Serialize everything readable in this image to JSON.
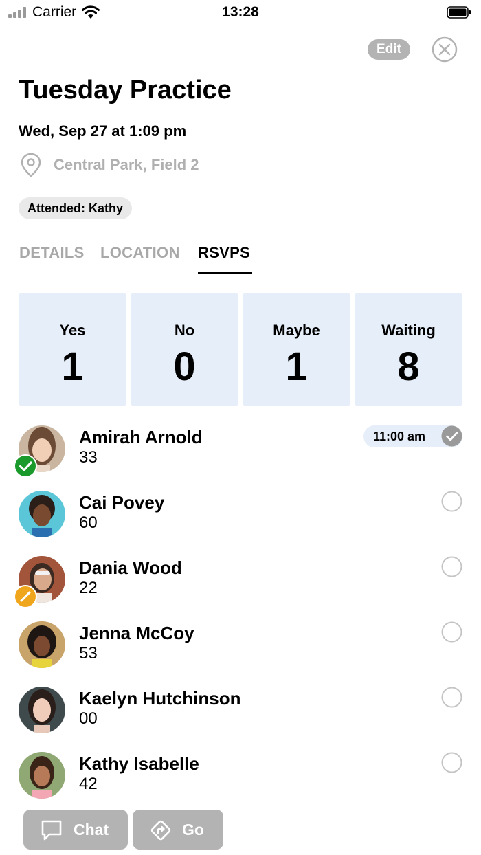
{
  "status_bar": {
    "carrier": "Carrier",
    "time": "13:28"
  },
  "header": {
    "edit_label": "Edit"
  },
  "event": {
    "title": "Tuesday Practice",
    "datetime": "Wed, Sep 27 at 1:09 pm",
    "location": "Central Park, Field 2",
    "attended_badge": "Attended: Kathy"
  },
  "tabs": [
    {
      "label": "DETAILS",
      "active": false
    },
    {
      "label": "LOCATION",
      "active": false
    },
    {
      "label": "RSVPS",
      "active": true
    }
  ],
  "stats": [
    {
      "label": "Yes",
      "value": "1"
    },
    {
      "label": "No",
      "value": "0"
    },
    {
      "label": "Maybe",
      "value": "1"
    },
    {
      "label": "Waiting",
      "value": "8"
    }
  ],
  "rsvps": [
    {
      "name": "Amirah Arnold",
      "number": "33",
      "status": "yes",
      "time": "11:00 am",
      "checked_in": true
    },
    {
      "name": "Cai Povey",
      "number": "60",
      "status": "waiting",
      "checked_in": false
    },
    {
      "name": "Dania Wood",
      "number": "22",
      "status": "maybe",
      "checked_in": false
    },
    {
      "name": "Jenna McCoy",
      "number": "53",
      "status": "waiting",
      "checked_in": false
    },
    {
      "name": "Kaelyn Hutchinson",
      "number": "00",
      "status": "waiting",
      "checked_in": false
    },
    {
      "name": "Kathy Isabelle",
      "number": "42",
      "status": "waiting",
      "checked_in": false
    }
  ],
  "bottom_bar": {
    "chat_label": "Chat",
    "go_label": "Go"
  },
  "colors": {
    "card_bg": "#e6eef9",
    "yes_green": "#1a9a2a",
    "maybe_orange": "#f0a61c",
    "muted_gray": "#b3b3b3"
  }
}
